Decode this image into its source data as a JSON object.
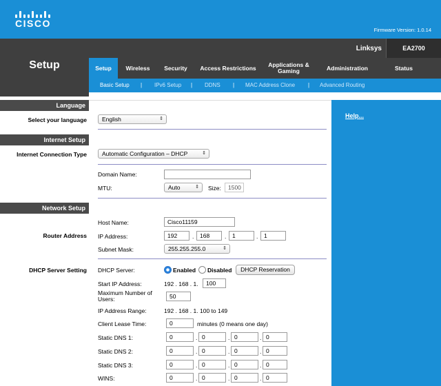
{
  "brand": {
    "logo_text": "CISCO",
    "firmware": "Firmware Version: 1.0.14",
    "linksys": "Linksys",
    "model": "EA2700",
    "section_title": "Setup",
    "colors": {
      "accent": "#1a8fd6",
      "dark": "#3f3f3f"
    }
  },
  "tabs": [
    {
      "label": "Setup",
      "active": true
    },
    {
      "label": "Wireless"
    },
    {
      "label": "Security"
    },
    {
      "label": "Access Restrictions"
    },
    {
      "label": "Applications & Gaming"
    },
    {
      "label": "Administration"
    },
    {
      "label": "Status"
    }
  ],
  "subtabs": [
    {
      "label": "Basic Setup",
      "active": true
    },
    {
      "label": "IPv6 Setup"
    },
    {
      "label": "DDNS"
    },
    {
      "label": "MAC Address Clone"
    },
    {
      "label": "Advanced Routing"
    }
  ],
  "subtab_separator": "|",
  "left": {
    "language_header": "Language",
    "select_language": "Select your language",
    "internet_header": "Internet Setup",
    "connection_type": "Internet Connection Type",
    "network_header": "Network Setup",
    "router_address": "Router Address",
    "dhcp_setting": "DHCP Server Setting"
  },
  "help": {
    "label": "Help..."
  },
  "form": {
    "language": {
      "value": "English"
    },
    "connection": {
      "value": "Automatic Configuration – DHCP"
    },
    "domain_name": {
      "label": "Domain Name:",
      "value": ""
    },
    "mtu": {
      "label": "MTU:",
      "mode": "Auto",
      "size_label": "Size:",
      "size": "1500"
    },
    "host_name": {
      "label": "Host Name:",
      "value": "Cisco11159"
    },
    "ip_address": {
      "label": "IP Address:",
      "octets": [
        "192",
        "168",
        "1",
        "1"
      ]
    },
    "subnet_mask": {
      "label": "Subnet Mask:",
      "value": "255.255.255.0"
    },
    "dhcp_server": {
      "label": "DHCP Server:",
      "enabled_label": "Enabled",
      "disabled_label": "Disabled",
      "enabled": true,
      "reservation_label": "DHCP Reservation"
    },
    "start_ip": {
      "label": "Start IP  Address:",
      "prefix": "192 . 168 . 1.",
      "value": "100"
    },
    "max_users": {
      "label": "Maximum Number of Users:",
      "value": "50"
    },
    "ip_range": {
      "label": "IP Address Range:",
      "value": "192 . 168 . 1. 100 to 149"
    },
    "lease_time": {
      "label": "Client Lease Time:",
      "value": "0",
      "suffix": "minutes (0 means one day)"
    },
    "dns1": {
      "label": "Static DNS 1:",
      "octets": [
        "0",
        "0",
        "0",
        "0"
      ]
    },
    "dns2": {
      "label": "Static DNS 2:",
      "octets": [
        "0",
        "0",
        "0",
        "0"
      ]
    },
    "dns3": {
      "label": "Static DNS 3:",
      "octets": [
        "0",
        "0",
        "0",
        "0"
      ]
    },
    "wins": {
      "label": "WINS:",
      "octets": [
        "0",
        "0",
        "0",
        "0"
      ]
    },
    "select_arrow": "⇕"
  }
}
